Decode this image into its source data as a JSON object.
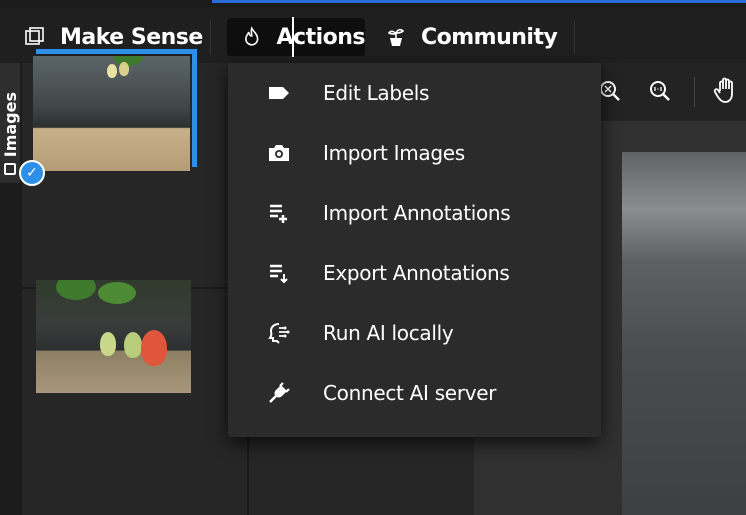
{
  "header": {
    "brand": "Make Sense",
    "actions": "Actions",
    "community": "Community"
  },
  "sidebar": {
    "tab_label": "Images"
  },
  "menu": {
    "items": [
      {
        "label": "Edit Labels",
        "icon": "label-tag-icon"
      },
      {
        "label": "Import Images",
        "icon": "camera-icon"
      },
      {
        "label": "Import Annotations",
        "icon": "import-list-icon"
      },
      {
        "label": "Export Annotations",
        "icon": "export-list-icon"
      },
      {
        "label": "Run AI locally",
        "icon": "ai-brain-icon"
      },
      {
        "label": "Connect AI server",
        "icon": "plug-icon"
      }
    ]
  },
  "toolbar": {
    "icons": [
      "zoom-fit-icon",
      "zoom-actual-icon",
      "pan-hand-icon"
    ]
  },
  "colors": {
    "accent": "#2e8fe8",
    "menu_bg": "#2b2b2b",
    "topbar_bg": "#1f1f1f"
  }
}
